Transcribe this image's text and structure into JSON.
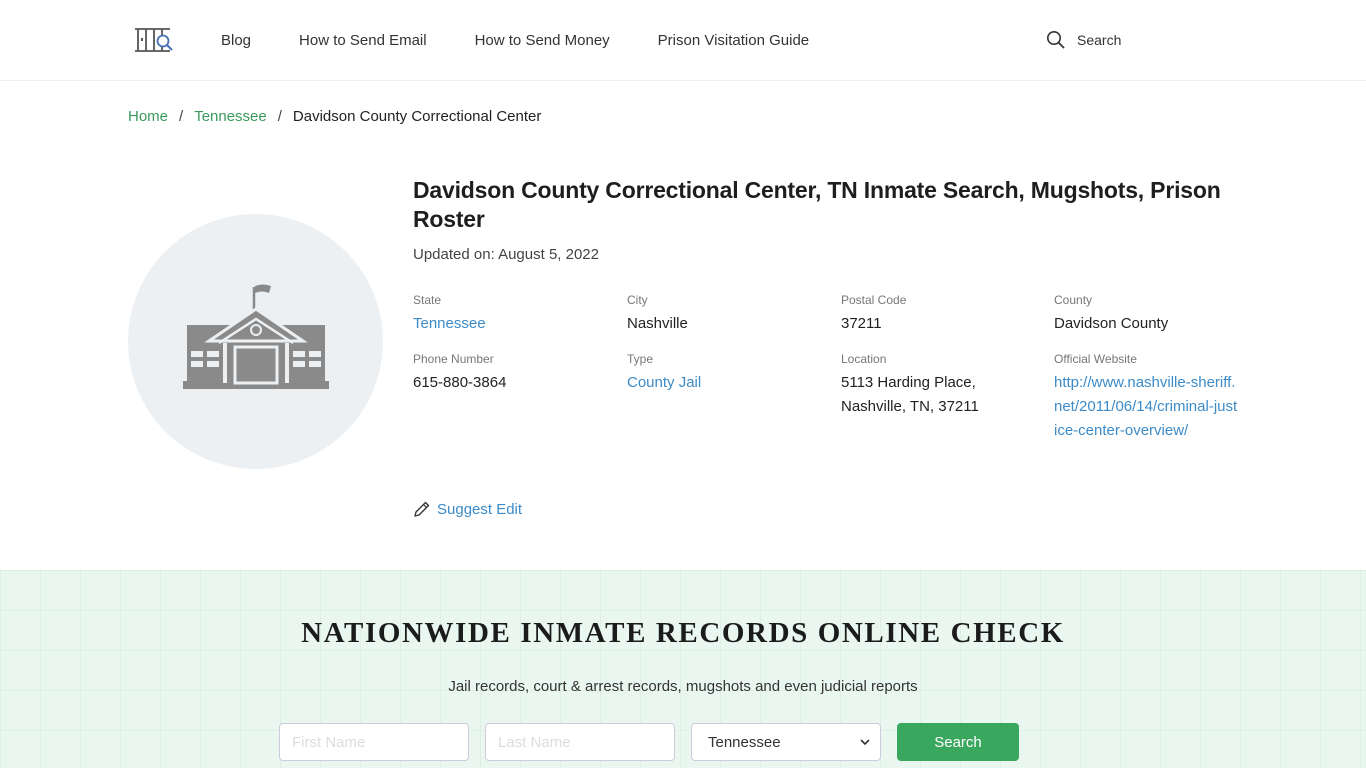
{
  "header": {
    "logo_icon": "jail-bars-search-icon",
    "nav": [
      {
        "label": "Blog"
      },
      {
        "label": "How to Send Email"
      },
      {
        "label": "How to Send Money"
      },
      {
        "label": "Prison Visitation Guide"
      }
    ],
    "search_label": "Search",
    "search_icon": "search-icon"
  },
  "breadcrumb": {
    "items": [
      {
        "label": "Home"
      },
      {
        "label": "Tennessee"
      }
    ],
    "separator": "/",
    "current": "Davidson County Correctional Center"
  },
  "facility": {
    "image_icon": "building-icon",
    "title": "Davidson County Correctional Center, TN Inmate Search, Mugshots, Prison Roster",
    "updated": "Updated on: August 5, 2022",
    "fields": {
      "state": {
        "label": "State",
        "value": "Tennessee"
      },
      "city": {
        "label": "City",
        "value": "Nashville"
      },
      "postal": {
        "label": "Postal Code",
        "value": "37211"
      },
      "county": {
        "label": "County",
        "value": "Davidson County"
      },
      "phone": {
        "label": "Phone Number",
        "value": "615-880-3864"
      },
      "type": {
        "label": "Type",
        "value": "County Jail"
      },
      "location": {
        "label": "Location",
        "line1": "5113 Harding Place,",
        "line2": "Nashville, TN, 37211"
      },
      "website": {
        "label": "Official Website",
        "value": "http://www.nashville-sheriff.net/2011/06/14/criminal-justice-center-overview/"
      }
    },
    "suggest_edit": "Suggest Edit"
  },
  "records": {
    "title": "NATIONWIDE INMATE RECORDS ONLINE CHECK",
    "subtitle": "Jail records, court & arrest records, mugshots and even judicial reports",
    "first_name_placeholder": "First Name",
    "last_name_placeholder": "Last Name",
    "state_selected": "Tennessee",
    "search_button": "Search"
  },
  "colors": {
    "green_link": "#3a9a5c",
    "blue_link": "#3c8bc8",
    "button_green": "#3aa75e",
    "band_bg": "#eaf7f0"
  }
}
